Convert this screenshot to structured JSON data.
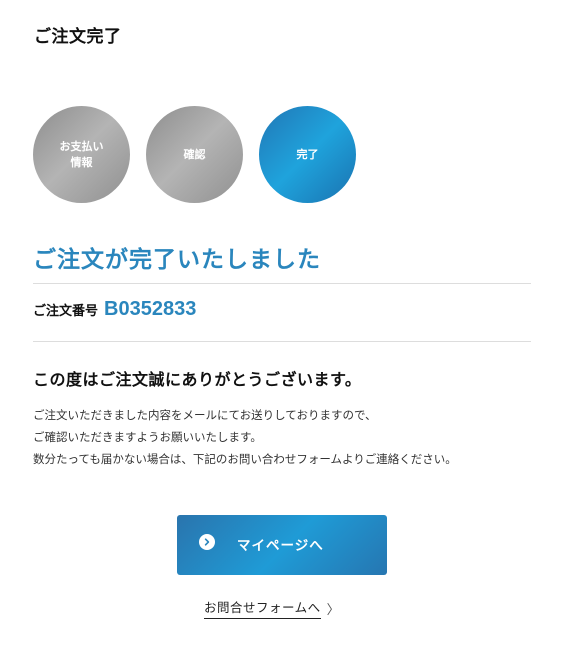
{
  "page": {
    "title": "ご注文完了"
  },
  "steps": [
    {
      "label": "お支払い\n情報",
      "status": "done"
    },
    {
      "label": "確認",
      "status": "done"
    },
    {
      "label": "完了",
      "status": "active"
    }
  ],
  "complete": {
    "heading": "ご注文が完了いたしました"
  },
  "order": {
    "label": "ご注文番号",
    "number": "B0352833"
  },
  "thanks": {
    "heading": "この度はご注文誠にありがとうございます。",
    "lines": [
      "ご注文いただきました内容をメールにてお送りしておりますので、",
      "ご確認いただきますようお願いいたします。",
      "数分たっても届かない場合は、下記のお問い合わせフォームよりご連絡ください。"
    ]
  },
  "actions": {
    "mypage_label": "マイページへ",
    "mypage_icon": "chevron-right-circle-icon",
    "contact_label": "お問合せフォームへ",
    "contact_arrow": "〉"
  },
  "colors": {
    "accent": "#2a86bd",
    "step_inactive": "#a3a3a3",
    "step_active": "#1f94d2",
    "divider": "#dddddd"
  }
}
